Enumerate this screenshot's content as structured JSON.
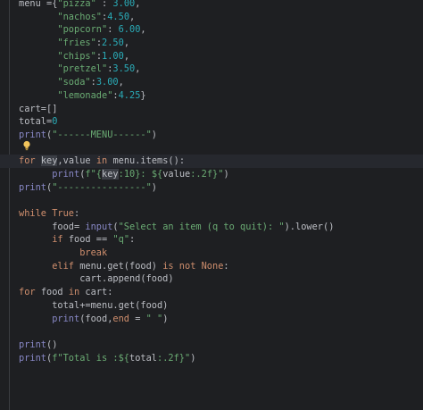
{
  "editor": {
    "lines": [
      [
        {
          "t": "menu ={",
          "c": "txt"
        },
        {
          "t": "\"pizza\"",
          "c": "str"
        },
        {
          "t": " : ",
          "c": "txt"
        },
        {
          "t": "3.00",
          "c": "num"
        },
        {
          "t": ",",
          "c": "txt"
        }
      ],
      [
        {
          "t": "       ",
          "c": "txt"
        },
        {
          "t": "\"nachos\"",
          "c": "str"
        },
        {
          "t": ":",
          "c": "txt"
        },
        {
          "t": "4.50",
          "c": "num"
        },
        {
          "t": ",",
          "c": "txt"
        }
      ],
      [
        {
          "t": "       ",
          "c": "txt"
        },
        {
          "t": "\"popcorn\"",
          "c": "str"
        },
        {
          "t": ": ",
          "c": "txt"
        },
        {
          "t": "6.00",
          "c": "num"
        },
        {
          "t": ",",
          "c": "txt"
        }
      ],
      [
        {
          "t": "       ",
          "c": "txt"
        },
        {
          "t": "\"fries\"",
          "c": "str"
        },
        {
          "t": ":",
          "c": "txt"
        },
        {
          "t": "2.50",
          "c": "num"
        },
        {
          "t": ",",
          "c": "txt"
        }
      ],
      [
        {
          "t": "       ",
          "c": "txt"
        },
        {
          "t": "\"chips\"",
          "c": "str"
        },
        {
          "t": ":",
          "c": "txt"
        },
        {
          "t": "1.00",
          "c": "num"
        },
        {
          "t": ",",
          "c": "txt"
        }
      ],
      [
        {
          "t": "       ",
          "c": "txt"
        },
        {
          "t": "\"pretzel\"",
          "c": "str"
        },
        {
          "t": ":",
          "c": "txt"
        },
        {
          "t": "3.50",
          "c": "num"
        },
        {
          "t": ",",
          "c": "txt"
        }
      ],
      [
        {
          "t": "       ",
          "c": "txt"
        },
        {
          "t": "\"soda\"",
          "c": "str"
        },
        {
          "t": ":",
          "c": "txt"
        },
        {
          "t": "3.00",
          "c": "num"
        },
        {
          "t": ",",
          "c": "txt"
        }
      ],
      [
        {
          "t": "       ",
          "c": "txt"
        },
        {
          "t": "\"lemonade\"",
          "c": "str"
        },
        {
          "t": ":",
          "c": "txt"
        },
        {
          "t": "4.25",
          "c": "num"
        },
        {
          "t": "}",
          "c": "txt"
        }
      ],
      [
        {
          "t": "cart=[]",
          "c": "txt"
        }
      ],
      [
        {
          "t": "total=",
          "c": "txt"
        },
        {
          "t": "0",
          "c": "num"
        }
      ],
      [
        {
          "t": "print",
          "c": "bi"
        },
        {
          "t": "(",
          "c": "txt"
        },
        {
          "t": "\"------MENU------\"",
          "c": "str"
        },
        {
          "t": ")",
          "c": "txt"
        }
      ],
      [
        {
          "t": "",
          "c": "txt"
        }
      ],
      [
        {
          "t": "for ",
          "c": "kw"
        },
        {
          "t": "key",
          "c": "hl"
        },
        {
          "t": ",value ",
          "c": "txt"
        },
        {
          "t": "in ",
          "c": "kw"
        },
        {
          "t": "menu.items():",
          "c": "txt"
        }
      ],
      [
        {
          "t": "      ",
          "c": "txt"
        },
        {
          "t": "print",
          "c": "bi"
        },
        {
          "t": "(",
          "c": "txt"
        },
        {
          "t": "f\"{",
          "c": "str"
        },
        {
          "t": "key",
          "c": "hl"
        },
        {
          "t": ":10}: ${",
          "c": "str"
        },
        {
          "t": "value",
          "c": "txt"
        },
        {
          "t": ":.2f}\"",
          "c": "str"
        },
        {
          "t": ")",
          "c": "txt"
        }
      ],
      [
        {
          "t": "print",
          "c": "bi"
        },
        {
          "t": "(",
          "c": "txt"
        },
        {
          "t": "\"----------------\"",
          "c": "str"
        },
        {
          "t": ")",
          "c": "txt"
        }
      ],
      [
        {
          "t": "",
          "c": "txt"
        }
      ],
      [
        {
          "t": "while ",
          "c": "kw"
        },
        {
          "t": "True",
          "c": "kw"
        },
        {
          "t": ":",
          "c": "txt"
        }
      ],
      [
        {
          "t": "      food= ",
          "c": "txt"
        },
        {
          "t": "input",
          "c": "bi"
        },
        {
          "t": "(",
          "c": "txt"
        },
        {
          "t": "\"Select an item (q to quit): \"",
          "c": "str"
        },
        {
          "t": ").lower()",
          "c": "txt"
        }
      ],
      [
        {
          "t": "      ",
          "c": "txt"
        },
        {
          "t": "if ",
          "c": "kw"
        },
        {
          "t": "food == ",
          "c": "txt"
        },
        {
          "t": "\"q\"",
          "c": "str"
        },
        {
          "t": ":",
          "c": "txt"
        }
      ],
      [
        {
          "t": "           ",
          "c": "txt"
        },
        {
          "t": "break",
          "c": "kw"
        }
      ],
      [
        {
          "t": "      ",
          "c": "txt"
        },
        {
          "t": "elif ",
          "c": "kw"
        },
        {
          "t": "menu.get(food) ",
          "c": "txt"
        },
        {
          "t": "is not ",
          "c": "kw"
        },
        {
          "t": "None",
          "c": "kw"
        },
        {
          "t": ":",
          "c": "txt"
        }
      ],
      [
        {
          "t": "           cart.append(food)",
          "c": "txt"
        }
      ],
      [
        {
          "t": "for ",
          "c": "kw"
        },
        {
          "t": "food ",
          "c": "txt"
        },
        {
          "t": "in ",
          "c": "kw"
        },
        {
          "t": "cart:",
          "c": "txt"
        }
      ],
      [
        {
          "t": "      total+=menu.get(food)",
          "c": "txt"
        }
      ],
      [
        {
          "t": "      ",
          "c": "txt"
        },
        {
          "t": "print",
          "c": "bi"
        },
        {
          "t": "(food,",
          "c": "txt"
        },
        {
          "t": "end",
          "c": "kw"
        },
        {
          "t": " = ",
          "c": "txt"
        },
        {
          "t": "\" \"",
          "c": "str"
        },
        {
          "t": ")",
          "c": "txt"
        }
      ],
      [
        {
          "t": "",
          "c": "txt"
        }
      ],
      [
        {
          "t": "print",
          "c": "bi"
        },
        {
          "t": "()",
          "c": "txt"
        }
      ],
      [
        {
          "t": "print",
          "c": "bi"
        },
        {
          "t": "(",
          "c": "txt"
        },
        {
          "t": "f\"Total is :${",
          "c": "str"
        },
        {
          "t": "total",
          "c": "txt"
        },
        {
          "t": ":.2f}\"",
          "c": "str"
        },
        {
          "t": ")",
          "c": "txt"
        }
      ]
    ],
    "current_line_index": 12,
    "lightbulb_icon": "intention-bulb-icon"
  }
}
